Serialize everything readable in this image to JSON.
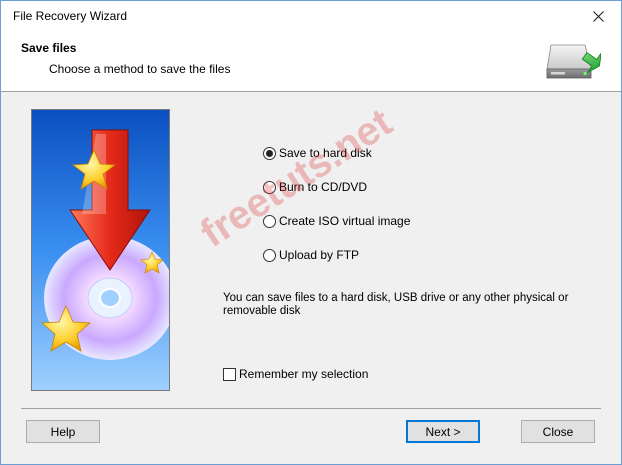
{
  "window": {
    "title": "File Recovery Wizard"
  },
  "header": {
    "title": "Save files",
    "subtitle": "Choose a method to save the files"
  },
  "options": [
    {
      "label": "Save to hard disk",
      "checked": true
    },
    {
      "label": "Burn to CD/DVD",
      "checked": false
    },
    {
      "label": "Create ISO virtual image",
      "checked": false
    },
    {
      "label": "Upload by FTP",
      "checked": false
    }
  ],
  "description": "You can save files to a hard disk, USB drive or any other physical or removable disk",
  "remember": {
    "label": "Remember my selection",
    "checked": false
  },
  "watermark": "freetuts.net",
  "buttons": {
    "help": "Help",
    "next": "Next >",
    "close": "Close"
  },
  "icons": {
    "close": "close-icon",
    "header": "hard-drive-save-icon",
    "side": "disc-download-illustration"
  }
}
